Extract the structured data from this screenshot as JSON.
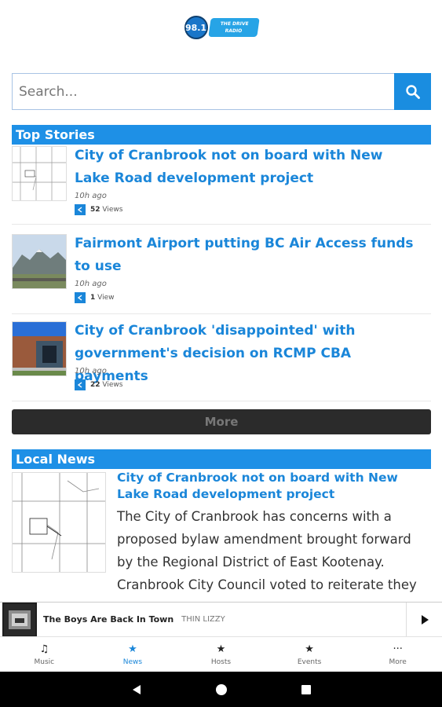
{
  "header": {
    "logo_number": "98.1",
    "logo_word": "THE DRIVE RADIO"
  },
  "search": {
    "placeholder": "Search..."
  },
  "top_stories": {
    "heading": "Top Stories",
    "items": [
      {
        "title": "City of Cranbrook not on board with New Lake Road development project",
        "time": "10h ago",
        "views_count": "52",
        "views_label": "Views"
      },
      {
        "title": "Fairmont Airport putting BC Air Access funds to use",
        "time": "10h ago",
        "views_count": "1",
        "views_label": "View"
      },
      {
        "title": "City of Cranbrook 'disappointed' with government's decision on RCMP CBA payments",
        "time": "10h ago",
        "views_count": "22",
        "views_label": "Views"
      }
    ],
    "more_label": "More"
  },
  "local_news": {
    "heading": "Local News",
    "item": {
      "title": "City of Cranbrook not on board with New Lake Road development project",
      "body": "The City of Cranbrook has concerns with a proposed bylaw amendment brought forward by the Regional District of East Kootenay. Cranbrook City Council voted to reiterate they are not in favour of expanding the Regional..."
    }
  },
  "player": {
    "song": "The Boys Are Back In Town",
    "artist": "THIN LIZZY",
    "icon": "play-icon"
  },
  "bottom_nav": [
    {
      "label": "Music",
      "icon": "music-note-icon",
      "active": false
    },
    {
      "label": "News",
      "icon": "star-icon",
      "active": true
    },
    {
      "label": "Hosts",
      "icon": "star-icon",
      "active": false
    },
    {
      "label": "Events",
      "icon": "star-icon",
      "active": false
    },
    {
      "label": "More",
      "icon": "more-dots-icon",
      "active": false
    }
  ],
  "colors": {
    "accent": "#1e90e6",
    "link": "#1a86d9",
    "more_button": "#2b2b2b"
  }
}
